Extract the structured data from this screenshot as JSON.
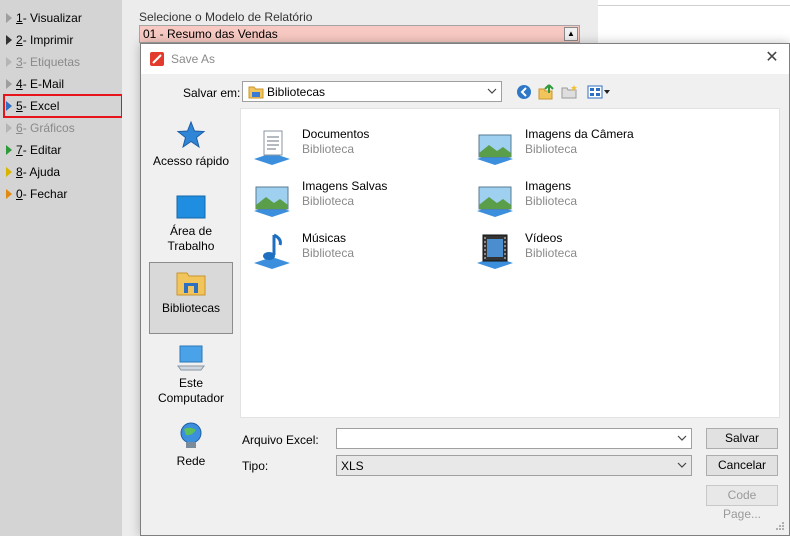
{
  "app_menu": {
    "items": [
      {
        "key": "1",
        "text": " - Visualizar",
        "enabled": true,
        "color": "#9e9e9e"
      },
      {
        "key": "2",
        "text": " - Imprimir",
        "enabled": true,
        "color": "#333333"
      },
      {
        "key": "3",
        "text": " - Etiquetas",
        "enabled": false,
        "color": "#b5b5b5"
      },
      {
        "key": "4",
        "text": " - E-Mail",
        "enabled": true,
        "color": "#9e9e9e"
      },
      {
        "key": "5",
        "text": " - Excel",
        "enabled": true,
        "color": "#2f6fc2"
      },
      {
        "key": "6",
        "text": " - Gráficos",
        "enabled": false,
        "color": "#b5b5b5"
      },
      {
        "key": "7",
        "text": " - Editar",
        "enabled": true,
        "color": "#2f9a3a"
      },
      {
        "key": "8",
        "text": " - Ajuda",
        "enabled": true,
        "color": "#d8b400"
      },
      {
        "key": "0",
        "text": " - Fechar",
        "enabled": true,
        "color": "#e08a12"
      }
    ]
  },
  "report": {
    "label": "Selecione o Modelo de Relatório",
    "selected": "01 - Resumo das Vendas"
  },
  "dialog": {
    "title": "Save As",
    "save_in_label": "Salvar em:",
    "save_in_value": "Bibliotecas",
    "places": [
      {
        "label": "Acesso rápido",
        "icon": "star-icon"
      },
      {
        "label": "Área de Trabalho",
        "icon": "desktop-icon"
      },
      {
        "label": "Bibliotecas",
        "icon": "libraries-icon"
      },
      {
        "label": "Este Computador",
        "icon": "computer-icon"
      },
      {
        "label": "Rede",
        "icon": "network-icon"
      }
    ],
    "files": [
      {
        "name": "Documentos",
        "type": "Biblioteca",
        "icon": "documents-library-icon"
      },
      {
        "name": "Imagens da Câmera",
        "type": "Biblioteca",
        "icon": "camera-roll-library-icon"
      },
      {
        "name": "Imagens Salvas",
        "type": "Biblioteca",
        "icon": "saved-pictures-library-icon"
      },
      {
        "name": "Imagens",
        "type": "Biblioteca",
        "icon": "pictures-library-icon"
      },
      {
        "name": "Músicas",
        "type": "Biblioteca",
        "icon": "music-library-icon"
      },
      {
        "name": "Vídeos",
        "type": "Biblioteca",
        "icon": "videos-library-icon"
      }
    ],
    "filename_label": "Arquivo Excel:",
    "filename_value": "",
    "type_label": "Tipo:",
    "type_value": "XLS",
    "save_button": "Salvar",
    "cancel_button": "Cancelar",
    "codepage_button": "Code Page..."
  }
}
